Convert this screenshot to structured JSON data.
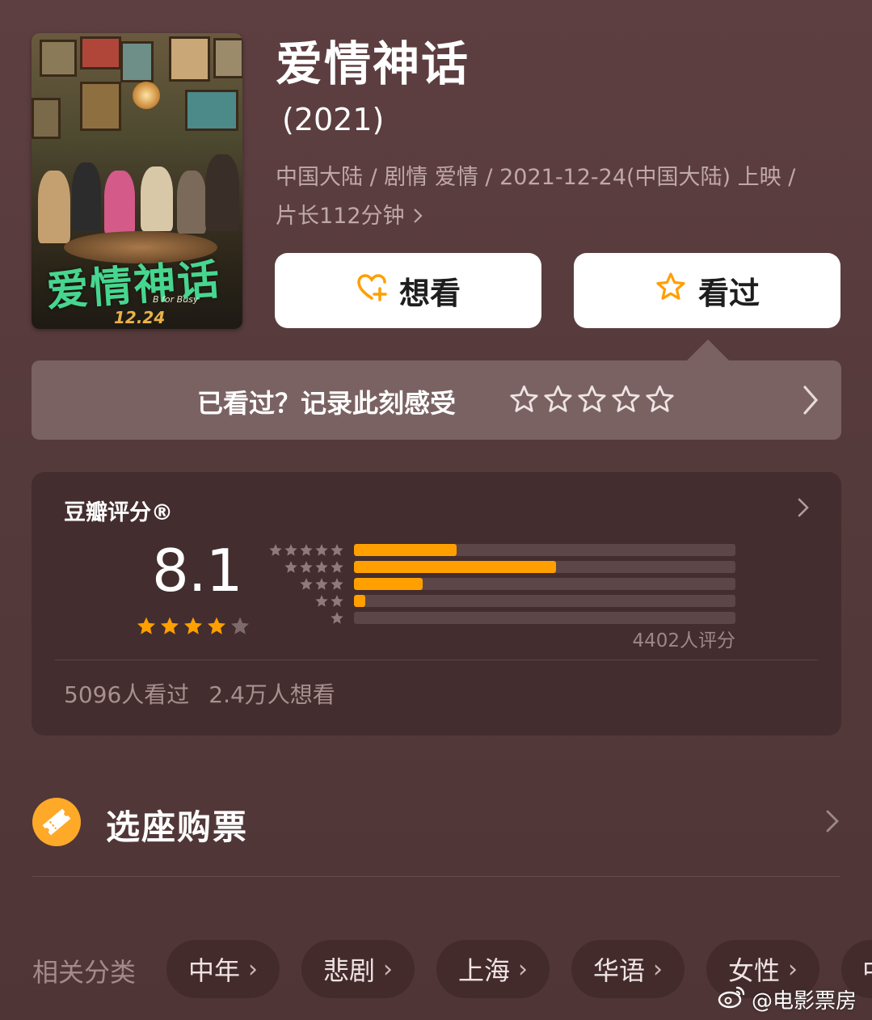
{
  "movie": {
    "title": "爱情神话",
    "year": "(2021)",
    "meta_line1": "中国大陆 / 剧情 爱情 / 2021-12-24(中国大陆) 上映 /",
    "meta_line2": "片长112分钟",
    "poster": {
      "title_art": "爱情神话",
      "date_art": "12.24",
      "tagline": "B for Busy"
    }
  },
  "actions": {
    "want_label": "想看",
    "watched_label": "看过"
  },
  "rate_prompt": {
    "text": "已看过？记录此刻感受"
  },
  "rating": {
    "title": "豆瓣评分®",
    "score": "8.1",
    "stars_filled": 4,
    "stars_total": 5,
    "distribution": [
      {
        "stars": 5,
        "fraction": 0.27
      },
      {
        "stars": 4,
        "fraction": 0.53
      },
      {
        "stars": 3,
        "fraction": 0.18
      },
      {
        "stars": 2,
        "fraction": 0.03
      },
      {
        "stars": 1,
        "fraction": 0.0
      }
    ],
    "votes": "4402人评分",
    "watched": "5096人看过",
    "wants": "2.4万人想看"
  },
  "ticket": {
    "label": "选座购票"
  },
  "related": {
    "label": "相关分类",
    "tags": [
      "中年",
      "悲剧",
      "上海",
      "华语",
      "女性",
      "中"
    ]
  },
  "watermark": {
    "text": "@电影票房"
  },
  "colors": {
    "accent": "#ff9f00",
    "background": "#5e3f41",
    "card": "#432d2e"
  }
}
